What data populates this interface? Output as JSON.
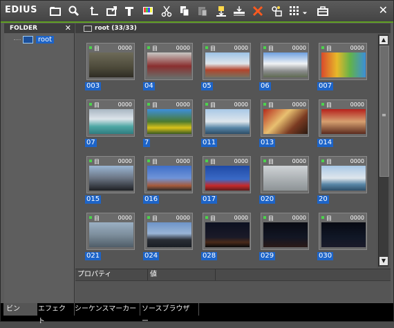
{
  "app": {
    "title": "EDIUS"
  },
  "toolbar": {
    "icons": [
      "folder-icon",
      "search-icon",
      "up-arrow-icon",
      "export-icon",
      "text-icon",
      "color-bars-icon",
      "cut-icon",
      "copy-icon",
      "paste-icon",
      "add-to-timeline-icon",
      "insert-icon",
      "delete-icon",
      "properties-icon",
      "view-mode-icon",
      "dropdown-icon",
      "bin-tools-icon"
    ],
    "close": "✕"
  },
  "folder": {
    "header": "FOLDER",
    "close": "✕",
    "root": "root"
  },
  "bin": {
    "header": "root (33/33)",
    "clip_symbol": "目",
    "clips": [
      {
        "name": "003",
        "tc": "0000",
        "thumb": "lake-duck"
      },
      {
        "name": "04",
        "tc": "0000",
        "thumb": "bus-station"
      },
      {
        "name": "05",
        "tc": "0000",
        "thumb": "mountain-train"
      },
      {
        "name": "06",
        "tc": "0000",
        "thumb": "mountain-snow"
      },
      {
        "name": "007",
        "tc": "0000",
        "thumb": "colorful-cube"
      },
      {
        "name": "07",
        "tc": "0000",
        "thumb": "lake-mountain"
      },
      {
        "name": "7",
        "tc": "0000",
        "thumb": "yellow-flowers"
      },
      {
        "name": "011",
        "tc": "0000",
        "thumb": "harbor-boats"
      },
      {
        "name": "013",
        "tc": "0000",
        "thumb": "theater-face"
      },
      {
        "name": "014",
        "tc": "0000",
        "thumb": "ride-people"
      },
      {
        "name": "015",
        "tc": "0000",
        "thumb": "carousel"
      },
      {
        "name": "016",
        "tc": "0000",
        "thumb": "ferris-wheel"
      },
      {
        "name": "017",
        "tc": "0000",
        "thumb": "rollercoaster"
      },
      {
        "name": "020",
        "tc": "0000",
        "thumb": "seagull"
      },
      {
        "name": "20",
        "tc": "0000",
        "thumb": "harbor-boats"
      },
      {
        "name": "021",
        "tc": "0000",
        "thumb": "sea-sail"
      },
      {
        "name": "024",
        "tc": "0000",
        "thumb": "city-skyline"
      },
      {
        "name": "028",
        "tc": "0000",
        "thumb": "night-city"
      },
      {
        "name": "029",
        "tc": "0000",
        "thumb": "night-city-dark"
      },
      {
        "name": "030",
        "tc": "0000",
        "thumb": "night-harbor"
      }
    ]
  },
  "properties": {
    "col1": "プロパティ",
    "col2": "値"
  },
  "tabs": [
    "ビン",
    "エフェクト",
    "シーケンスマーカー",
    "ソースブラウザー"
  ],
  "colors": {
    "accent": "#5fa021",
    "selection": "#1d64c8"
  }
}
